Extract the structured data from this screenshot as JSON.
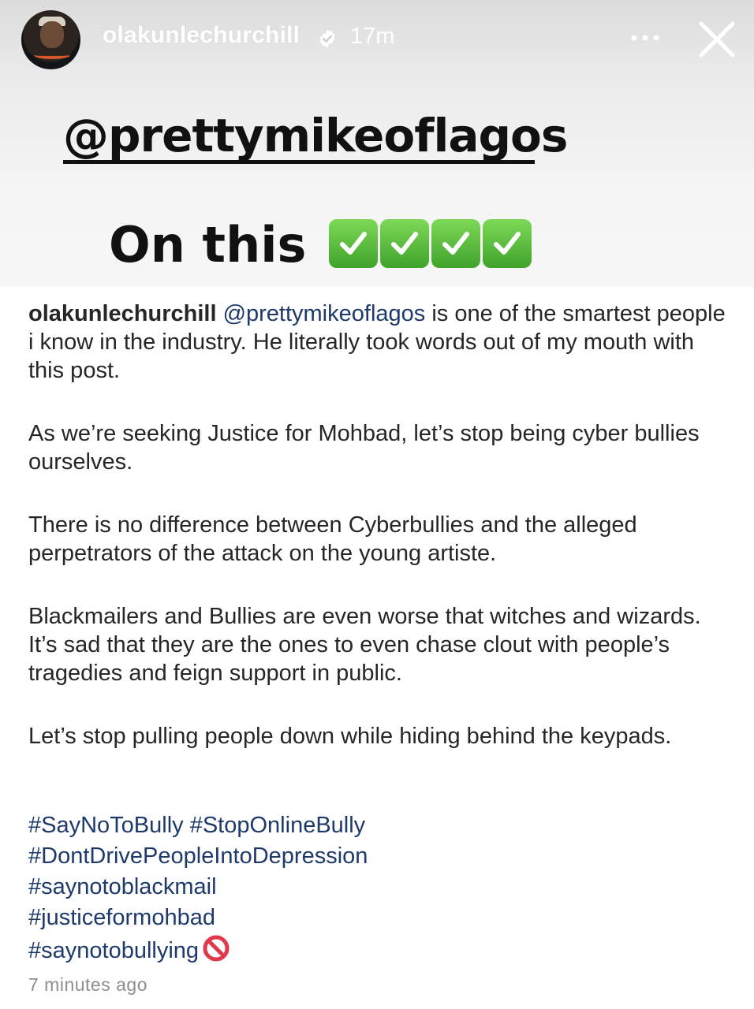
{
  "header": {
    "username": "olakunlechurchill",
    "time_ago": "17m"
  },
  "story_card": {
    "mention": "@prettymikeoflagos",
    "on_this": "On this",
    "check_count": 4
  },
  "caption": {
    "username": "olakunlechurchill",
    "mention": "@prettymikeoflagos",
    "first_paragraph_rest": " is one of the smartest people i know in the industry. He literally took words out of my mouth with this post.",
    "paragraphs": [
      "As we’re seeking  Justice for Mohbad, let’s stop being cyber bullies ourselves.",
      "There is no difference between Cyberbullies and the alleged perpetrators of the attack on the young artiste.",
      "Blackmailers and Bullies are even worse that witches and wizards. It’s sad that they are the ones to even chase clout with people’s tragedies and feign support in public.",
      "Let’s stop pulling people down while hiding behind the keypads."
    ],
    "hashtags": [
      "#SayNoToBully #StopOnlineBully",
      "#DontDrivePeopleIntoDepression",
      "#saynotoblackmail",
      "#justiceformohbad",
      "#saynotobullying"
    ],
    "timestamp": "7 minutes ago"
  },
  "colors": {
    "link": "#1e3a6b",
    "text": "#262626",
    "meta": "#8e8e8e",
    "check_green": "#4cb233"
  }
}
